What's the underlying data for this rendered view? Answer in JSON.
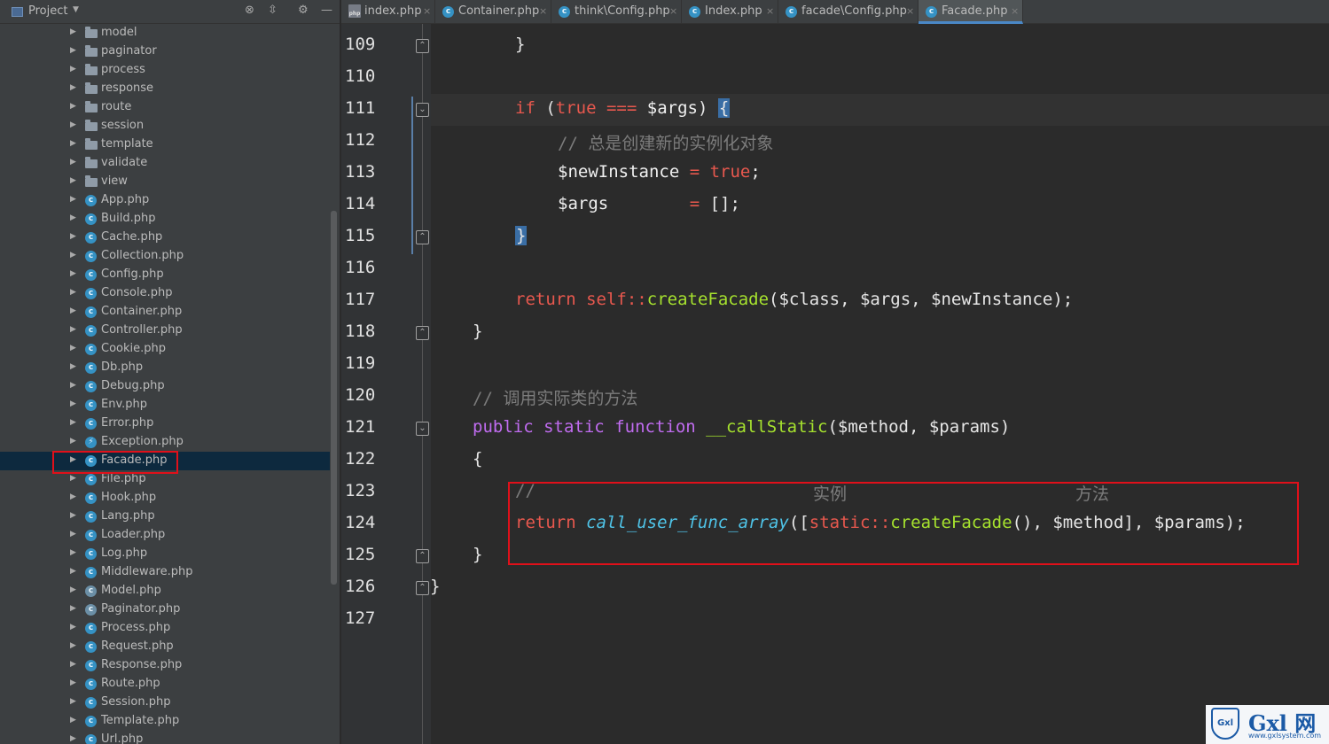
{
  "sidebar": {
    "title": "Project",
    "items": [
      {
        "label": "model",
        "type": "folder"
      },
      {
        "label": "paginator",
        "type": "folder"
      },
      {
        "label": "process",
        "type": "folder"
      },
      {
        "label": "response",
        "type": "folder"
      },
      {
        "label": "route",
        "type": "folder"
      },
      {
        "label": "session",
        "type": "folder"
      },
      {
        "label": "template",
        "type": "folder"
      },
      {
        "label": "validate",
        "type": "folder"
      },
      {
        "label": "view",
        "type": "folder"
      },
      {
        "label": "App.php",
        "type": "class"
      },
      {
        "label": "Build.php",
        "type": "class"
      },
      {
        "label": "Cache.php",
        "type": "class"
      },
      {
        "label": "Collection.php",
        "type": "class"
      },
      {
        "label": "Config.php",
        "type": "class"
      },
      {
        "label": "Console.php",
        "type": "class"
      },
      {
        "label": "Container.php",
        "type": "class"
      },
      {
        "label": "Controller.php",
        "type": "class"
      },
      {
        "label": "Cookie.php",
        "type": "class"
      },
      {
        "label": "Db.php",
        "type": "class"
      },
      {
        "label": "Debug.php",
        "type": "class"
      },
      {
        "label": "Env.php",
        "type": "class"
      },
      {
        "label": "Error.php",
        "type": "class"
      },
      {
        "label": "Exception.php",
        "type": "exception"
      },
      {
        "label": "Facade.php",
        "type": "class",
        "selected": true
      },
      {
        "label": "File.php",
        "type": "class"
      },
      {
        "label": "Hook.php",
        "type": "class"
      },
      {
        "label": "Lang.php",
        "type": "class"
      },
      {
        "label": "Loader.php",
        "type": "class"
      },
      {
        "label": "Log.php",
        "type": "class"
      },
      {
        "label": "Middleware.php",
        "type": "class"
      },
      {
        "label": "Model.php",
        "type": "abstract"
      },
      {
        "label": "Paginator.php",
        "type": "abstract"
      },
      {
        "label": "Process.php",
        "type": "class"
      },
      {
        "label": "Request.php",
        "type": "class"
      },
      {
        "label": "Response.php",
        "type": "class"
      },
      {
        "label": "Route.php",
        "type": "class"
      },
      {
        "label": "Session.php",
        "type": "class"
      },
      {
        "label": "Template.php",
        "type": "class"
      },
      {
        "label": "Url.php",
        "type": "class"
      }
    ]
  },
  "tabs": [
    {
      "label": "index.php",
      "icon": "php-file-icon"
    },
    {
      "label": "Container.php",
      "icon": "class-icon"
    },
    {
      "label": "think\\Config.php",
      "icon": "class-icon"
    },
    {
      "label": "Index.php",
      "icon": "class-icon"
    },
    {
      "label": "facade\\Config.php",
      "icon": "class-icon"
    },
    {
      "label": "Facade.php",
      "icon": "class-icon",
      "active": true
    }
  ],
  "editor": {
    "line_numbers": [
      "109",
      "110",
      "111",
      "112",
      "113",
      "114",
      "115",
      "116",
      "117",
      "118",
      "119",
      "120",
      "121",
      "122",
      "123",
      "124",
      "125",
      "126",
      "127"
    ],
    "lines": {
      "l109": {
        "brace": "}"
      },
      "l111": {
        "if": "if",
        "open": " (",
        "true": "true",
        "op": " === ",
        "var": "$args",
        "close": ") ",
        "brace": "{"
      },
      "l112": {
        "comment": "// 总是创建新的实例化对象"
      },
      "l113": {
        "var": "$newInstance",
        "op": " = ",
        "val": "true",
        "end": ";"
      },
      "l114": {
        "var": "$args",
        "op": "        = ",
        "val": "[];"
      },
      "l115": {
        "brace": "}"
      },
      "l117": {
        "ret": "return",
        "self": "self",
        "dc": "::",
        "fn": "createFacade",
        "args": "($class, $args, $newInstance);"
      },
      "l118": {
        "brace": "}"
      },
      "l120": {
        "comment": "// 调用实际类的方法"
      },
      "l121": {
        "public": "public",
        "static": "static",
        "function": "function",
        "name": "__callStatic",
        "args": "($method, $params)"
      },
      "l122": {
        "brace": "{"
      },
      "l123": {
        "comment1": "//",
        "comment2": "实例",
        "comment3": "方法"
      },
      "l124": {
        "ret": "return",
        "fn": "call_user_func_array",
        "open": "([",
        "static": "static",
        "dc": "::",
        "fn2": "createFacade",
        "rest": "(), $method], $params);"
      },
      "l125": {
        "brace": "}"
      },
      "l126": {
        "brace": "}"
      }
    }
  },
  "watermark": {
    "shield_text": "Gxl",
    "brand": "Gxl 网",
    "url": "www.gxlsystem.com"
  },
  "colors": {
    "keyword": "#e8584e",
    "function": "#a6e22e",
    "builtin_italic": "#4fc4e8",
    "comment": "#7c7c7c",
    "highlight_box": "#e0101a",
    "selection": "#0d293e"
  }
}
